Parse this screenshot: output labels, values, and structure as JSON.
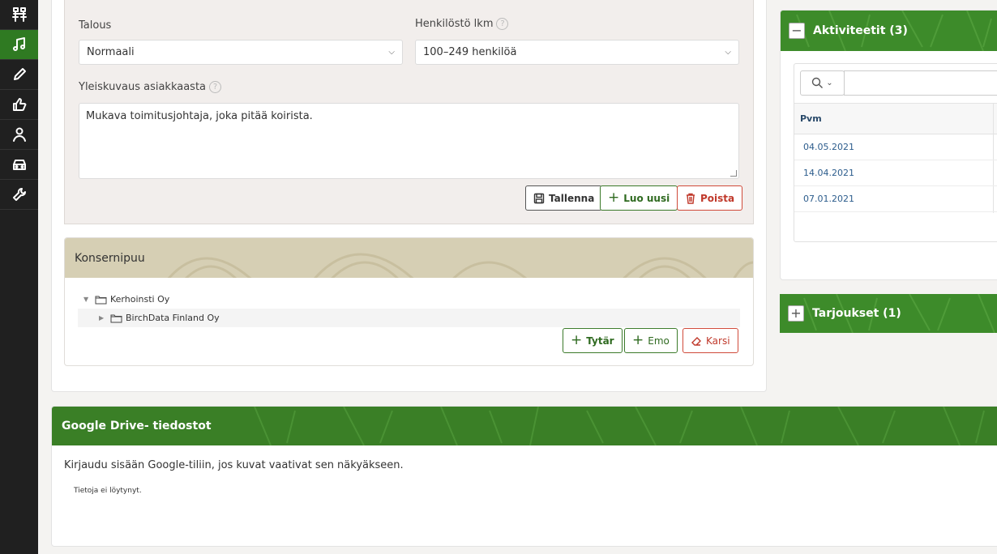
{
  "sidebar": {
    "items": [
      {
        "icon": "sitemap-icon",
        "active": false
      },
      {
        "icon": "music-icon",
        "active": true
      },
      {
        "icon": "pencil-icon",
        "active": false
      },
      {
        "icon": "thumbs-up-icon",
        "active": false
      },
      {
        "icon": "user-icon",
        "active": false
      },
      {
        "icon": "car-icon",
        "active": false
      },
      {
        "icon": "wrench-icon",
        "active": false
      }
    ]
  },
  "form": {
    "talous_label": "Talous",
    "talous_value": "Normaali",
    "henkilosto_label": "Henkilöstö lkm",
    "henkilosto_value": "100–249 henkilöä",
    "yleiskuvaus_label": "Yleiskuvaus asiakkaasta",
    "yleiskuvaus_value": "Mukava toimitusjohtaja, joka pitää koirista.",
    "save_label": "Tallenna",
    "new_label": "Luo uusi",
    "delete_label": "Poista",
    "help_glyph": "?"
  },
  "tree": {
    "title": "Konsernipuu",
    "root": "Kerhoinsti Oy",
    "child": "BirchData Finland Oy",
    "daughter_label": "Tytär",
    "parent_label": "Emo",
    "prune_label": "Karsi"
  },
  "activities": {
    "title": "Aktiviteetit (3)",
    "toggle": "−",
    "column_date": "Pvm",
    "rows": [
      "04.05.2021",
      "14.04.2021",
      "07.01.2021"
    ]
  },
  "offers": {
    "title": "Tarjoukset (1)",
    "toggle": "+"
  },
  "drive": {
    "title": "Google Drive- tiedostot",
    "login_text": "Kirjaudu sisään Google-tiliin, jos kuvat vaativat sen näkyäkseen.",
    "empty_text": "Tietoja ei löytynyt."
  },
  "colors": {
    "accent_green": "#3d8b2a",
    "sidebar_bg": "#202020",
    "danger": "#c0392b",
    "tan_header": "#d6cfb4"
  }
}
